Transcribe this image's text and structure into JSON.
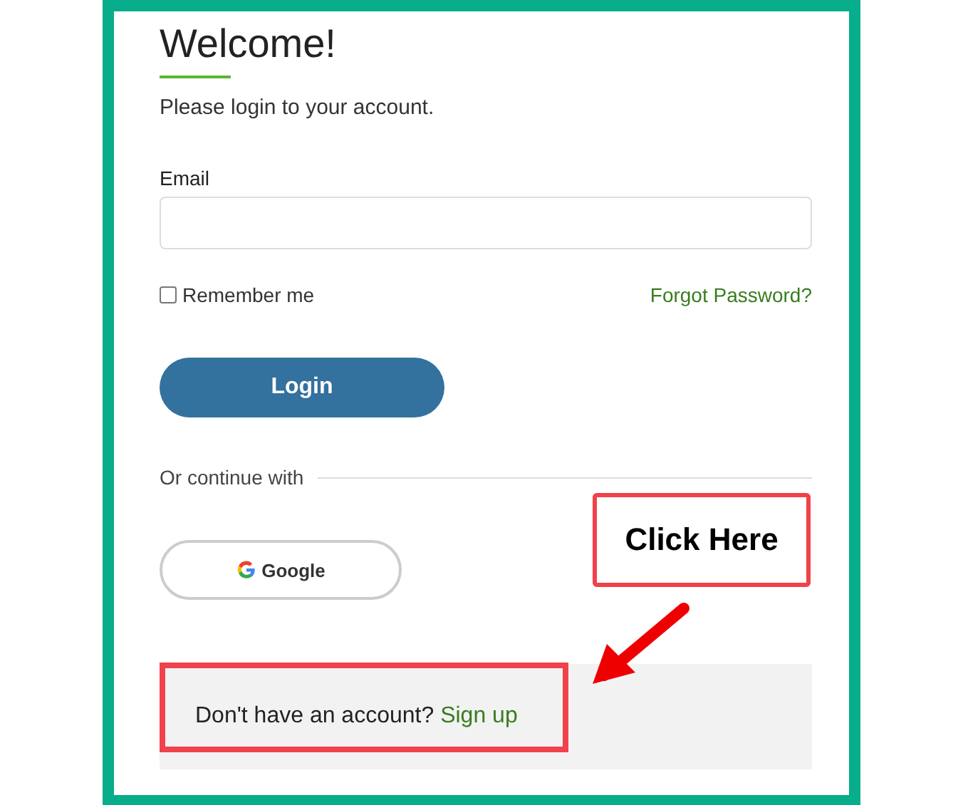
{
  "heading": "Welcome!",
  "subtitle": "Please login to your account.",
  "email": {
    "label": "Email"
  },
  "remember": {
    "label": "Remember me",
    "checked": false
  },
  "forgot_link": "Forgot Password?",
  "login_button": "Login",
  "divider_text": "Or continue with",
  "google_button": "Google",
  "signup": {
    "prompt": "Don't have an account?",
    "link": "Sign up"
  },
  "callout": "Click Here"
}
